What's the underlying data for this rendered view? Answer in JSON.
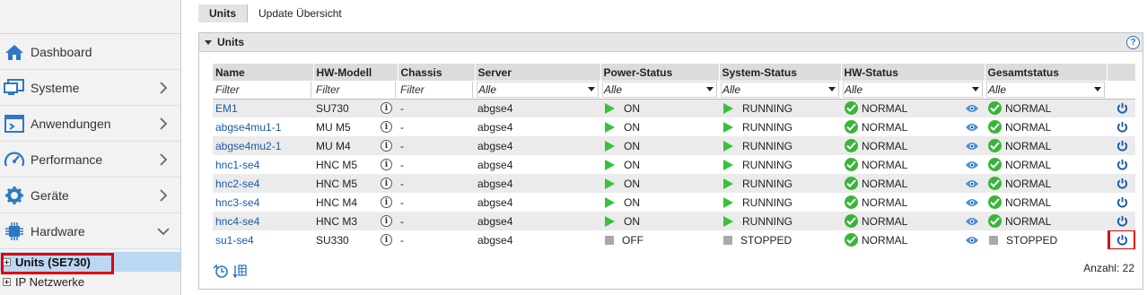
{
  "sidebar": {
    "items": [
      {
        "label": "Dashboard",
        "icon": "home-icon",
        "chevron": ""
      },
      {
        "label": "Systeme",
        "icon": "monitor-icon",
        "chevron": "right"
      },
      {
        "label": "Anwendungen",
        "icon": "window-icon",
        "chevron": "right"
      },
      {
        "label": "Performance",
        "icon": "gauge-icon",
        "chevron": "right"
      },
      {
        "label": "Geräte",
        "icon": "gear-icon",
        "chevron": "right"
      },
      {
        "label": "Hardware",
        "icon": "chip-icon",
        "chevron": "down"
      }
    ],
    "tree": [
      {
        "label": "Units (SE730)",
        "selected": true
      },
      {
        "label": "IP Netzwerke",
        "selected": false
      }
    ]
  },
  "tabs": [
    {
      "label": "Units",
      "active": true
    },
    {
      "label": "Update Übersicht",
      "active": false
    }
  ],
  "panel": {
    "title": "Units",
    "help": "?"
  },
  "table": {
    "columns": [
      "Name",
      "HW-Modell",
      "Chassis",
      "Server",
      "Power-Status",
      "System-Status",
      "HW-Status",
      "Gesamtstatus",
      ""
    ],
    "filters": {
      "name": "Filter",
      "model": "Filter",
      "chassis": "Filter",
      "server": "Alle",
      "power": "Alle",
      "system": "Alle",
      "hw": "Alle",
      "total": "Alle"
    },
    "rows": [
      {
        "name": "EM1",
        "model": "SU730",
        "chassis": "-",
        "server": "abgse4",
        "power": "ON",
        "system": "RUNNING",
        "hw": "NORMAL",
        "total": "NORMAL"
      },
      {
        "name": "abgse4mu1-1",
        "model": "MU M5",
        "chassis": "-",
        "server": "abgse4",
        "power": "ON",
        "system": "RUNNING",
        "hw": "NORMAL",
        "total": "NORMAL"
      },
      {
        "name": "abgse4mu2-1",
        "model": "MU M4",
        "chassis": "-",
        "server": "abgse4",
        "power": "ON",
        "system": "RUNNING",
        "hw": "NORMAL",
        "total": "NORMAL"
      },
      {
        "name": "hnc1-se4",
        "model": "HNC M5",
        "chassis": "-",
        "server": "abgse4",
        "power": "ON",
        "system": "RUNNING",
        "hw": "NORMAL",
        "total": "NORMAL"
      },
      {
        "name": "hnc2-se4",
        "model": "HNC M5",
        "chassis": "-",
        "server": "abgse4",
        "power": "ON",
        "system": "RUNNING",
        "hw": "NORMAL",
        "total": "NORMAL"
      },
      {
        "name": "hnc3-se4",
        "model": "HNC M4",
        "chassis": "-",
        "server": "abgse4",
        "power": "ON",
        "system": "RUNNING",
        "hw": "NORMAL",
        "total": "NORMAL"
      },
      {
        "name": "hnc4-se4",
        "model": "HNC M3",
        "chassis": "-",
        "server": "abgse4",
        "power": "ON",
        "system": "RUNNING",
        "hw": "NORMAL",
        "total": "NORMAL"
      },
      {
        "name": "su1-se4",
        "model": "SU330",
        "chassis": "-",
        "server": "abgse4",
        "power": "OFF",
        "system": "STOPPED",
        "hw": "NORMAL",
        "total": "STOPPED"
      }
    ]
  },
  "footer": {
    "count_label": "Anzahl: 22"
  },
  "colors": {
    "accent": "#1a5aa6",
    "ok_green": "#3ab43a",
    "play_green": "#3ac13a",
    "stopped_gray": "#a9a9a9",
    "highlight_red": "#e00000",
    "selected_blue": "#bcd7f2"
  }
}
